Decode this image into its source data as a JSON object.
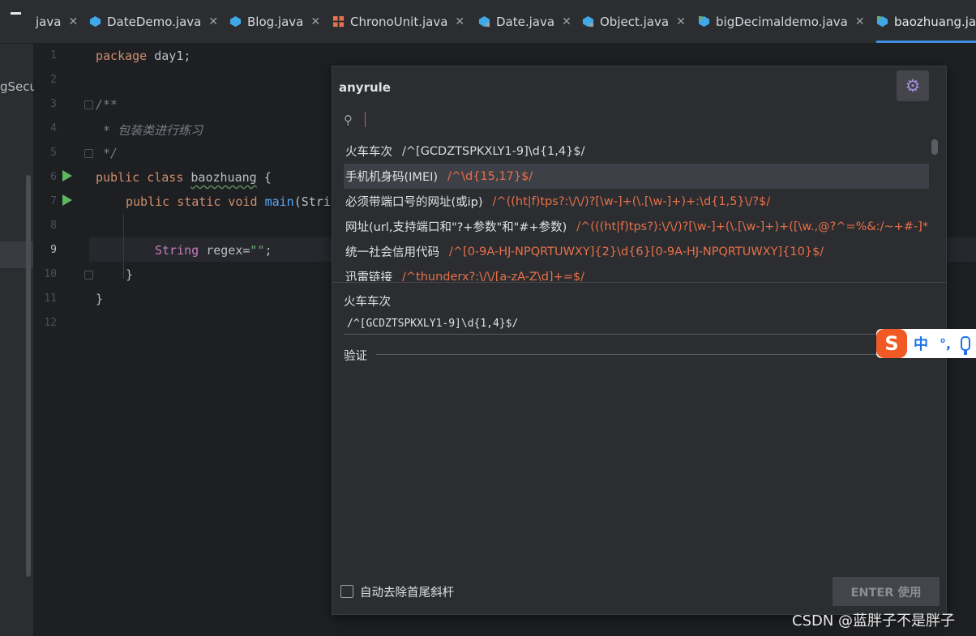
{
  "tabs": [
    {
      "label": "java",
      "icon": "java-file-icon",
      "active": false
    },
    {
      "label": "DateDemo.java",
      "icon": "java-class-icon",
      "active": false
    },
    {
      "label": "Blog.java",
      "icon": "java-class-icon",
      "active": false
    },
    {
      "label": "ChronoUnit.java",
      "icon": "enum-icon",
      "active": false
    },
    {
      "label": "Date.java",
      "icon": "java-class-icon",
      "active": false
    },
    {
      "label": "Object.java",
      "icon": "java-class-icon",
      "active": false
    },
    {
      "label": "bigDecimaldemo.java",
      "icon": "java-class-icon",
      "active": false
    },
    {
      "label": "baozhuang.jav",
      "icon": "java-class-icon",
      "active": true
    }
  ],
  "close_glyph": "✕",
  "project": {
    "partial_label": "gSecu"
  },
  "editor": {
    "line_numbers": [
      "1",
      "2",
      "3",
      "4",
      "5",
      "6",
      "7",
      "8",
      "9",
      "10",
      "11",
      "12"
    ],
    "current_line": "9",
    "lines": {
      "l1_kw": "package",
      "l1_rest": " day1;",
      "l3": "/**",
      "l4": " * 包装类进行练习",
      "l5": " */",
      "l6_kw": "public class",
      "l6_cls": "baozhuang",
      "l6_rest": " {",
      "l7_kw": "public static void",
      "l7_fn": "main",
      "l7_rest": "(Strin",
      "l9_type": "String",
      "l9_var": " regex=",
      "l9_str": "\"\"",
      "l9_end": ";",
      "l10": "}",
      "l11": "}"
    }
  },
  "anyrule": {
    "title": "anyrule",
    "search_placeholder": "",
    "rules": [
      {
        "name": "火车车次",
        "regex": "/^[GCDZTSPKXLY1-9]\\d{1,4}$/"
      },
      {
        "name": "手机机身码(IMEI)",
        "regex": "/^\\d{15,17}$/"
      },
      {
        "name": "必须带端口号的网址(或ip)",
        "regex": "/^((ht|f)tps?:\\/\\/)?[\\w-]+(\\.[\\w-]+)+:\\d{1,5}\\/?$/"
      },
      {
        "name": "网址(url,支持端口和\"?+参数\"和\"#+参数)",
        "regex": "/^(((ht|f)tps?):\\/\\/)?[\\w-]+(\\.[\\w-]+)+([\\w.,@?^=%&:/~+#-]*[\\"
      },
      {
        "name": "统一社会信用代码",
        "regex": "/^[0-9A-HJ-NPQRTUWXY]{2}\\d{6}[0-9A-HJ-NPQRTUWXY]{10}$/"
      },
      {
        "name": "迅雷链接",
        "regex": "/^thunderx?:\\/\\/[a-zA-Z\\d]+=$/"
      }
    ],
    "selected_index": 1,
    "detail": {
      "name": "火车车次",
      "regex": "/^[GCDZTSPKXLY1-9]\\d{1,4}$/",
      "verify_label": "验证"
    },
    "checkbox_label": "自动去除首尾斜杆",
    "enter_button": "ENTER 使用"
  },
  "ime": {
    "logo": "S",
    "mode": "中",
    "punct": "°,"
  },
  "watermark": "CSDN @蓝胖子不是胖子",
  "colors": {
    "accent": "#3e8fe0",
    "keyword": "#cf8e6d",
    "regex_text": "#e8704a",
    "run_marker": "#5fb85f",
    "gear": "#a38bdc"
  }
}
